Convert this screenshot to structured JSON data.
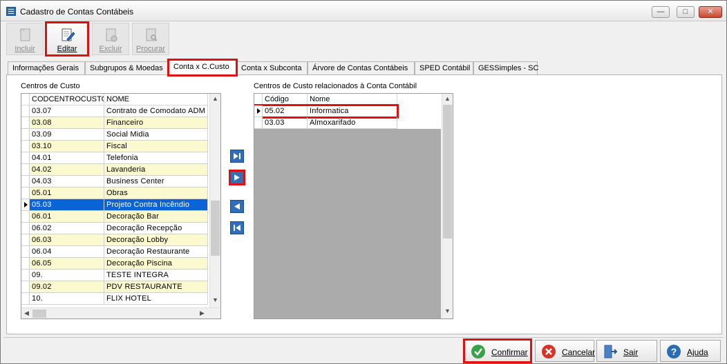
{
  "window": {
    "title": "Cadastro de Contas Contábeis"
  },
  "toolbar": {
    "incluir": "Incluir",
    "editar": "Editar",
    "excluir": "Excluir",
    "procurar": "Procurar"
  },
  "tabs": [
    {
      "label": "Informações Gerais"
    },
    {
      "label": "Subgrupos & Moedas"
    },
    {
      "label": "Conta x C.Custo"
    },
    {
      "label": "Conta x Subconta"
    },
    {
      "label": "Árvore de Contas Contábeis"
    },
    {
      "label": "SPED Contábil"
    },
    {
      "label": "GESSimples - SC"
    }
  ],
  "left": {
    "label": "Centros de Custo",
    "columns": {
      "code": "CODCENTROCUSTO",
      "name": "NOME"
    },
    "rows": [
      {
        "code": "03.07",
        "name": "Contrato de Comodato ADM"
      },
      {
        "code": "03.08",
        "name": "Financeiro"
      },
      {
        "code": "03.09",
        "name": "Social Midia"
      },
      {
        "code": "03.10",
        "name": "Fiscal"
      },
      {
        "code": "04.01",
        "name": "Telefonia"
      },
      {
        "code": "04.02",
        "name": "Lavanderia"
      },
      {
        "code": "04.03",
        "name": "Business Center"
      },
      {
        "code": "05.01",
        "name": "Obras"
      },
      {
        "code": "05.03",
        "name": "Projeto Contra Incêndio"
      },
      {
        "code": "06.01",
        "name": "Decoração Bar"
      },
      {
        "code": "06.02",
        "name": "Decoração Recepção"
      },
      {
        "code": "06.03",
        "name": "Decoração Lobby"
      },
      {
        "code": "06.04",
        "name": "Decoração Restaurante"
      },
      {
        "code": "06.05",
        "name": "Decoração Piscina"
      },
      {
        "code": "09.",
        "name": "TESTE INTEGRA"
      },
      {
        "code": "09.02",
        "name": "PDV RESTAURANTE"
      },
      {
        "code": "10.",
        "name": "FLIX HOTEL"
      }
    ]
  },
  "right": {
    "label": "Centros de Custo relacionados à Conta Contábil",
    "columns": {
      "code": "Código",
      "name": "Nome"
    },
    "rows": [
      {
        "code": "05.02",
        "name": "Informatica"
      },
      {
        "code": "03.03",
        "name": "Almoxarifado"
      }
    ]
  },
  "footer": {
    "confirmar": "Confirmar",
    "cancelar": "Cancelar",
    "sair": "Sair",
    "ajuda": "Ajuda"
  },
  "colors": {
    "selection": "#0a64d4",
    "alt_row": "#fbf9cf",
    "highlight": "#e01010",
    "move_button": "#2e6fb8"
  }
}
